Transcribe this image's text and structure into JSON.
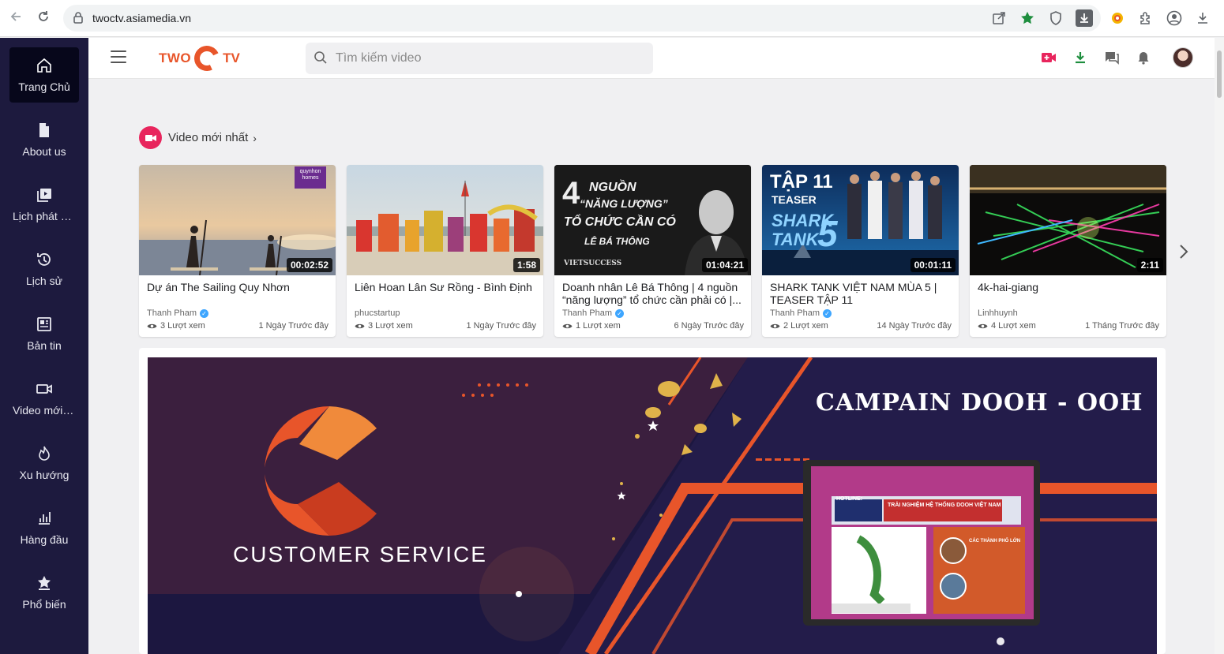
{
  "browser": {
    "url": "twoctv.asiamedia.vn"
  },
  "app": {
    "logo_left": "TWO",
    "logo_right": "TV",
    "search_placeholder": "Tìm kiếm video"
  },
  "sidebar": {
    "items": [
      {
        "label": "Trang Chủ",
        "icon": "home-icon",
        "active": true
      },
      {
        "label": "About us",
        "icon": "document-icon",
        "active": false
      },
      {
        "label": "Lịch phát sóng",
        "icon": "playlist-icon",
        "active": false
      },
      {
        "label": "Lịch sử",
        "icon": "history-icon",
        "active": false
      },
      {
        "label": "Bản tin",
        "icon": "news-icon",
        "active": false
      },
      {
        "label": "Video mới nhất",
        "icon": "video-camera-icon",
        "active": false
      },
      {
        "label": "Xu hướng",
        "icon": "flame-icon",
        "active": false
      },
      {
        "label": "Hàng đầu",
        "icon": "bar-chart-icon",
        "active": false
      },
      {
        "label": "Phổ biến",
        "icon": "star-badge-icon",
        "active": false
      }
    ]
  },
  "section": {
    "title": "Video mới nhất"
  },
  "videos": [
    {
      "title": "Dự án The Sailing Quy Nhơn",
      "channel": "Thanh Pham",
      "verified": true,
      "views": "3 Lượt xem",
      "time": "1 Ngày Trước đây",
      "duration": "00:02:52",
      "thumb_text": "quynhon homes"
    },
    {
      "title": "Liên Hoan Lân Sư Rồng - Bình Định",
      "channel": "phucstartup",
      "verified": false,
      "views": "3 Lượt xem",
      "time": "1 Ngày Trước đây",
      "duration": "1:58"
    },
    {
      "title": "Doanh nhân Lê Bá Thông | 4 nguồn “năng lượng” tổ chức cần phải có |...",
      "channel": "Thanh Pham",
      "verified": true,
      "views": "1 Lượt xem",
      "time": "6 Ngày Trước đây",
      "duration": "01:04:21",
      "thumb_lines": [
        "4",
        "NGUỒN",
        "“NĂNG LƯỢNG”",
        "TỔ CHỨC CẦN CÓ",
        "LÊ BÁ THÔNG",
        "VIETSUCCESS"
      ]
    },
    {
      "title": "SHARK TANK VIỆT NAM MÙA 5 | TEASER TẬP 11",
      "channel": "Thanh Pham",
      "verified": true,
      "views": "2 Lượt xem",
      "time": "14 Ngày Trước đây",
      "duration": "00:01:11",
      "thumb_lines": [
        "TẬP 11",
        "TEASER",
        "SHARK",
        "TANK",
        "5"
      ]
    },
    {
      "title": "4k-hai-giang",
      "channel": "Linhhuynh",
      "verified": false,
      "views": "4 Lượt xem",
      "time": "1 Tháng Trước đây",
      "duration": "2:11"
    }
  ],
  "banner": {
    "left_text": "CUSTOMER SERVICE",
    "headline": "CAMPAIN DOOH - OOH",
    "screen_hotline": "HOTLINE:",
    "screen_tagline": "TRẢI NGHIỆM HỆ THỐNG DOOH VIỆT NAM",
    "screen_cities": "CÁC THÀNH PHỐ LỚN"
  },
  "colors": {
    "sidebar_bg": "#1d1a3e",
    "sidebar_active": "#07071b",
    "brand": "#e8552a",
    "record_red": "#e8255d",
    "banner_bg": "#231c4a"
  }
}
